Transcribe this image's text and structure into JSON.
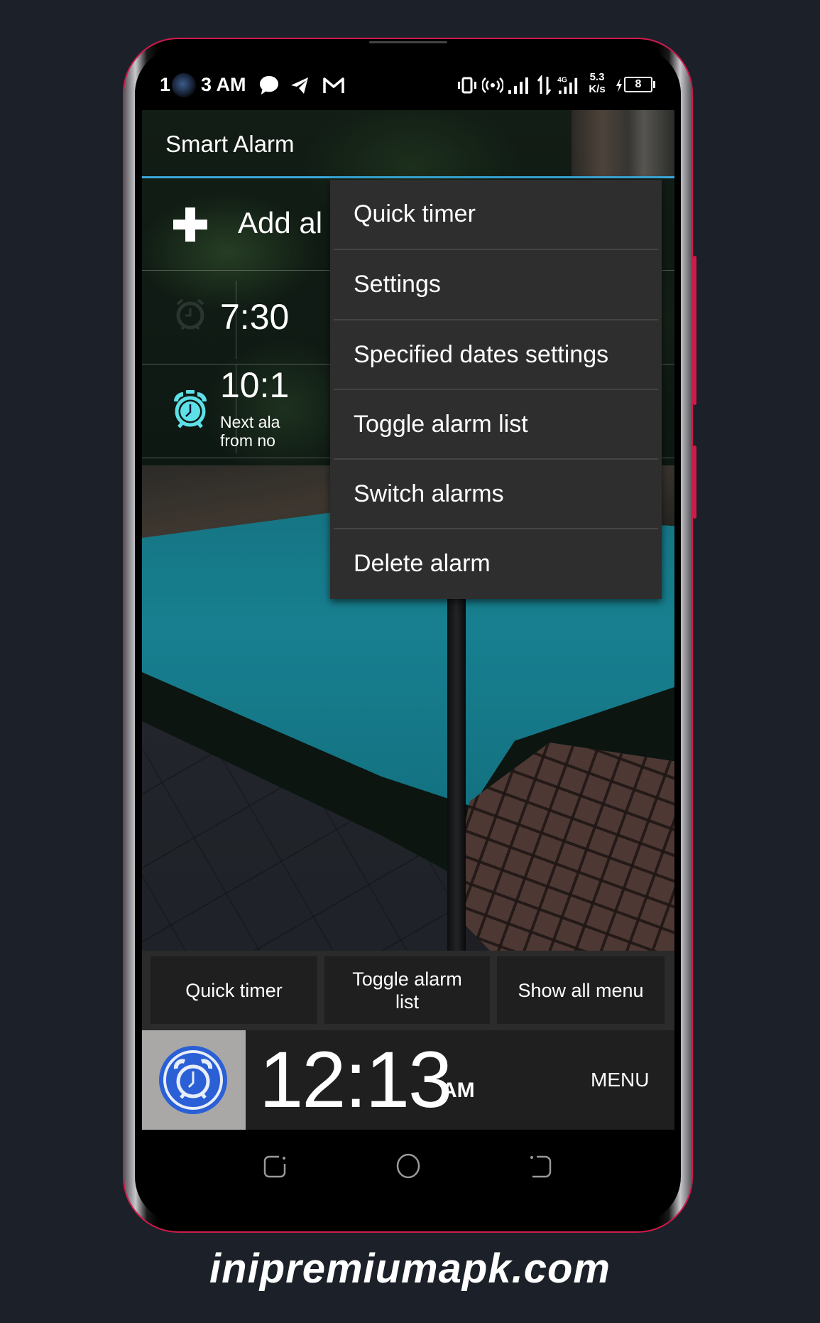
{
  "status_bar": {
    "time_left": "1",
    "time_right": "3 AM",
    "notification_icons": [
      "chat-bubble-icon",
      "telegram-icon",
      "gmail-icon"
    ],
    "system_icons": [
      "vibrate-icon",
      "hotspot-icon",
      "signal-icon",
      "data-arrows-icon",
      "4g-signal-icon"
    ],
    "network_type": "4G",
    "net_speed_value": "5.3",
    "net_speed_unit": "K/s",
    "battery_level": "8"
  },
  "app": {
    "title": "Smart Alarm",
    "accent_color": "#3aa8d8"
  },
  "alarm_list": {
    "add_label": "Add al",
    "alarms": [
      {
        "time": "7:30",
        "icon": "alarm-off-icon",
        "enabled": false
      },
      {
        "time": "10:1",
        "icon": "alarm-on-icon",
        "enabled": true,
        "next_line1": "Next ala",
        "next_line2": "from no"
      }
    ]
  },
  "overflow_menu": {
    "items": [
      {
        "label": "Quick timer"
      },
      {
        "label": "Settings"
      },
      {
        "label": "Specified dates settings"
      },
      {
        "label": "Toggle alarm list"
      },
      {
        "label": "Switch alarms"
      },
      {
        "label": "Delete alarm"
      }
    ]
  },
  "quick_buttons": [
    {
      "label": "Quick timer"
    },
    {
      "label": "Toggle alarm\nlist"
    },
    {
      "label": "Show all menu"
    }
  ],
  "clock_bar": {
    "time": "12:13",
    "ampm": "AM",
    "menu_label": "MENU"
  },
  "nav_bar": {
    "buttons": [
      "recent-apps",
      "home",
      "back"
    ]
  },
  "watermark": "inipremiumapk.com"
}
